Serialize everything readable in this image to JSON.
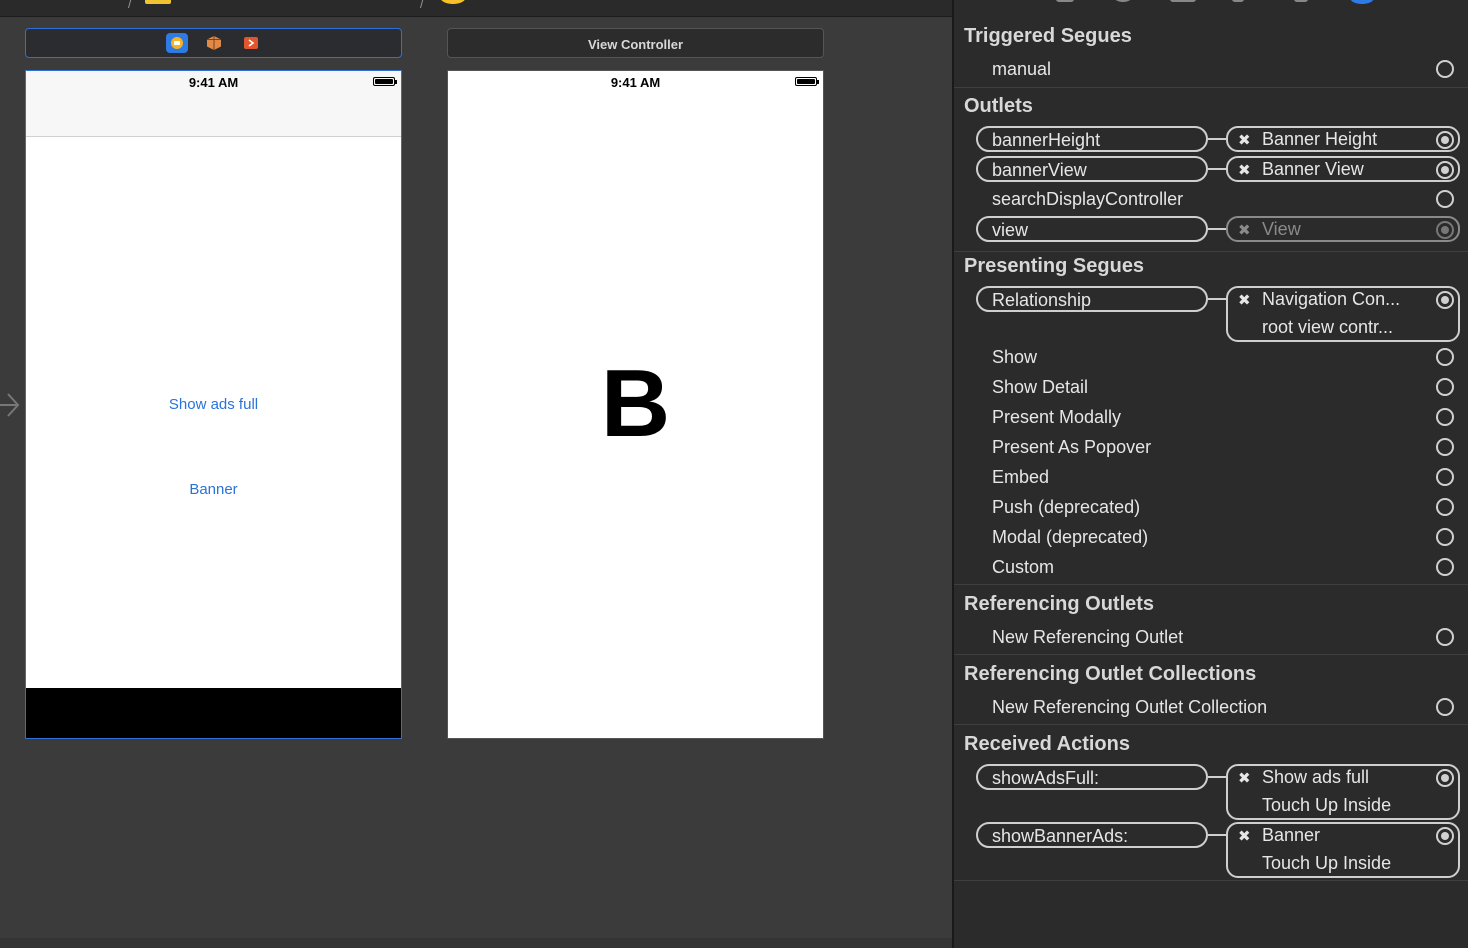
{
  "canvas": {
    "scene_a": {
      "status_time": "9:41 AM",
      "buttons": [
        "Show ads full",
        "Banner"
      ]
    },
    "scene_b": {
      "title": "View Controller",
      "status_time": "9:41 AM",
      "big_label": "B"
    }
  },
  "inspector": {
    "triggered_segues": {
      "header": "Triggered Segues",
      "rows": [
        "manual"
      ]
    },
    "outlets": {
      "header": "Outlets",
      "rows": [
        {
          "name": "bannerHeight",
          "target": "Banner Height"
        },
        {
          "name": "bannerView",
          "target": "Banner View"
        },
        {
          "name": "searchDisplayController"
        },
        {
          "name": "view",
          "target": "View"
        }
      ]
    },
    "presenting_segues": {
      "header": "Presenting Segues",
      "relationship": {
        "name": "Relationship",
        "target_line1": "Navigation Con...",
        "target_line2": "root view contr..."
      },
      "rows": [
        "Show",
        "Show Detail",
        "Present Modally",
        "Present As Popover",
        "Embed",
        "Push (deprecated)",
        "Modal (deprecated)",
        "Custom"
      ]
    },
    "referencing_outlets": {
      "header": "Referencing Outlets",
      "rows": [
        "New Referencing Outlet"
      ]
    },
    "referencing_outlet_collections": {
      "header": "Referencing Outlet Collections",
      "rows": [
        "New Referencing Outlet Collection"
      ]
    },
    "received_actions": {
      "header": "Received Actions",
      "rows": [
        {
          "name": "showAdsFull:",
          "target_line1": "Show ads full",
          "target_line2": "Touch Up Inside"
        },
        {
          "name": "showBannerAds:",
          "target_line1": "Banner",
          "target_line2": "Touch Up Inside"
        }
      ]
    },
    "remove_glyph": "✖"
  },
  "colors": {
    "accent": "#2f6fd6",
    "ios_link": "#2a73d9",
    "panel_bg": "#2b2b2c",
    "canvas_bg": "#3b3b3c"
  }
}
